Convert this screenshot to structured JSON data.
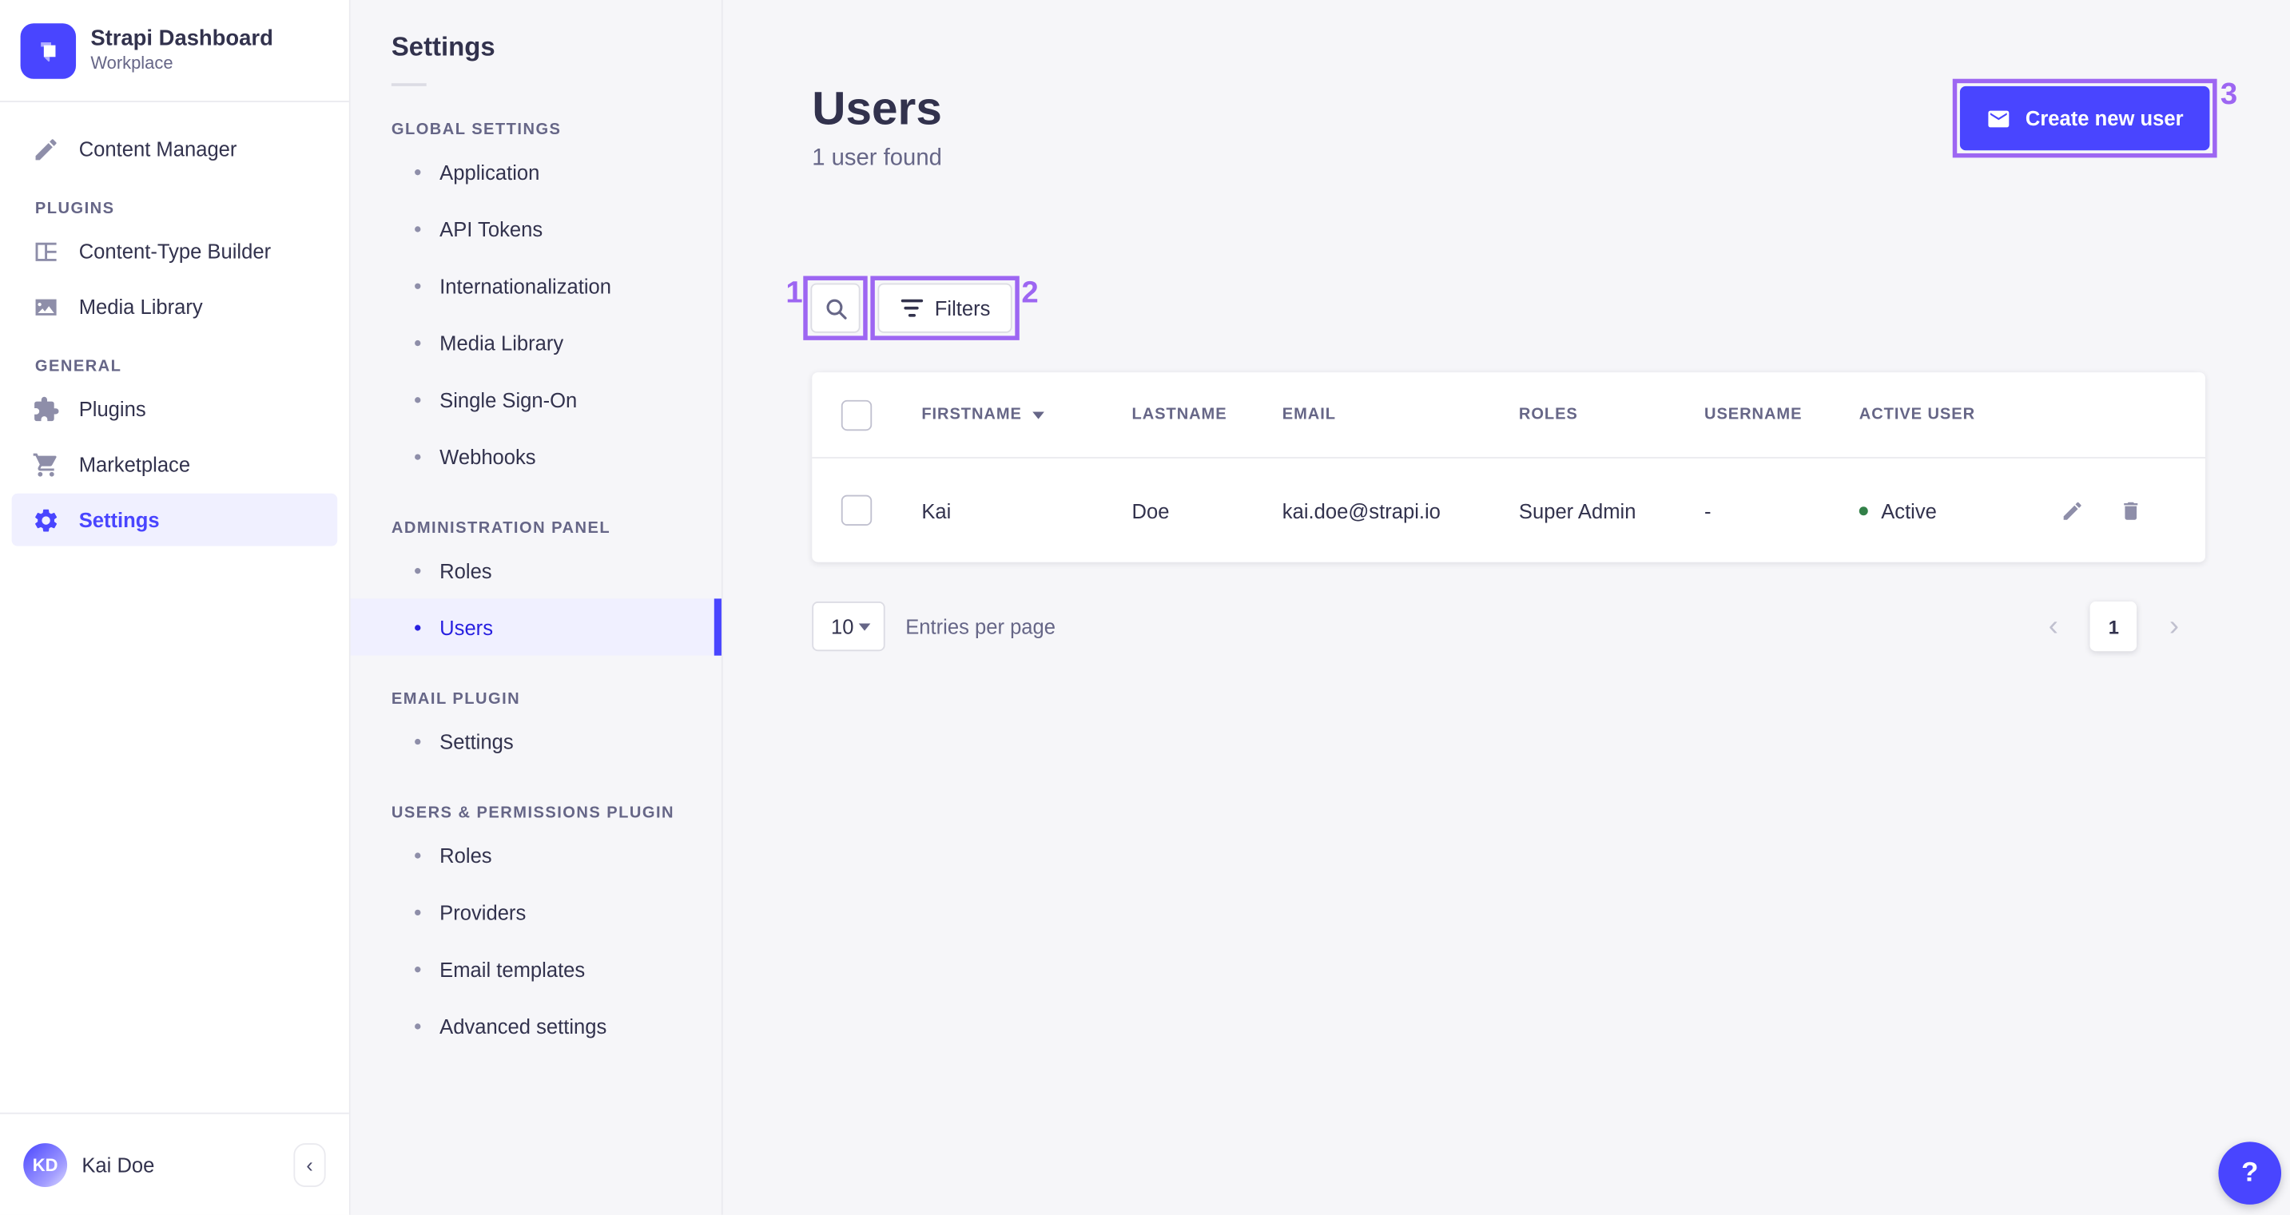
{
  "app": {
    "title": "Strapi Dashboard",
    "workspace": "Workplace"
  },
  "nav": {
    "content_manager": "Content Manager",
    "sections": [
      {
        "title": "PLUGINS",
        "items": [
          "Content-Type Builder",
          "Media Library"
        ]
      },
      {
        "title": "GENERAL",
        "items": [
          "Plugins",
          "Marketplace",
          "Settings"
        ]
      }
    ],
    "user": {
      "initials": "KD",
      "name": "Kai Doe"
    }
  },
  "subnav": {
    "title": "Settings",
    "sections": [
      {
        "title": "GLOBAL SETTINGS",
        "items": [
          "Application",
          "API Tokens",
          "Internationalization",
          "Media Library",
          "Single Sign-On",
          "Webhooks"
        ]
      },
      {
        "title": "ADMINISTRATION PANEL",
        "items": [
          "Roles",
          "Users"
        ],
        "active_item": "Users"
      },
      {
        "title": "EMAIL PLUGIN",
        "items": [
          "Settings"
        ]
      },
      {
        "title": "USERS & PERMISSIONS PLUGIN",
        "items": [
          "Roles",
          "Providers",
          "Email templates",
          "Advanced settings"
        ]
      }
    ]
  },
  "page": {
    "title": "Users",
    "subtitle": "1 user found",
    "create_button": "Create new user",
    "filters_button": "Filters"
  },
  "table": {
    "headers": [
      "FIRSTNAME",
      "LASTNAME",
      "EMAIL",
      "ROLES",
      "USERNAME",
      "ACTIVE USER"
    ],
    "rows": [
      {
        "firstname": "Kai",
        "lastname": "Doe",
        "email": "kai.doe@strapi.io",
        "roles": "Super Admin",
        "username": "-",
        "active_status": "Active"
      }
    ]
  },
  "pagination": {
    "page_size": "10",
    "entries_label": "Entries per page",
    "current_page": "1"
  },
  "annotations": {
    "search": "1",
    "filters": "2",
    "create": "3"
  },
  "help_label": "?",
  "colors": {
    "primary": "#4945ff",
    "annotation": "#9d66f2",
    "success": "#328048",
    "active_bg": "#f0f0ff"
  }
}
